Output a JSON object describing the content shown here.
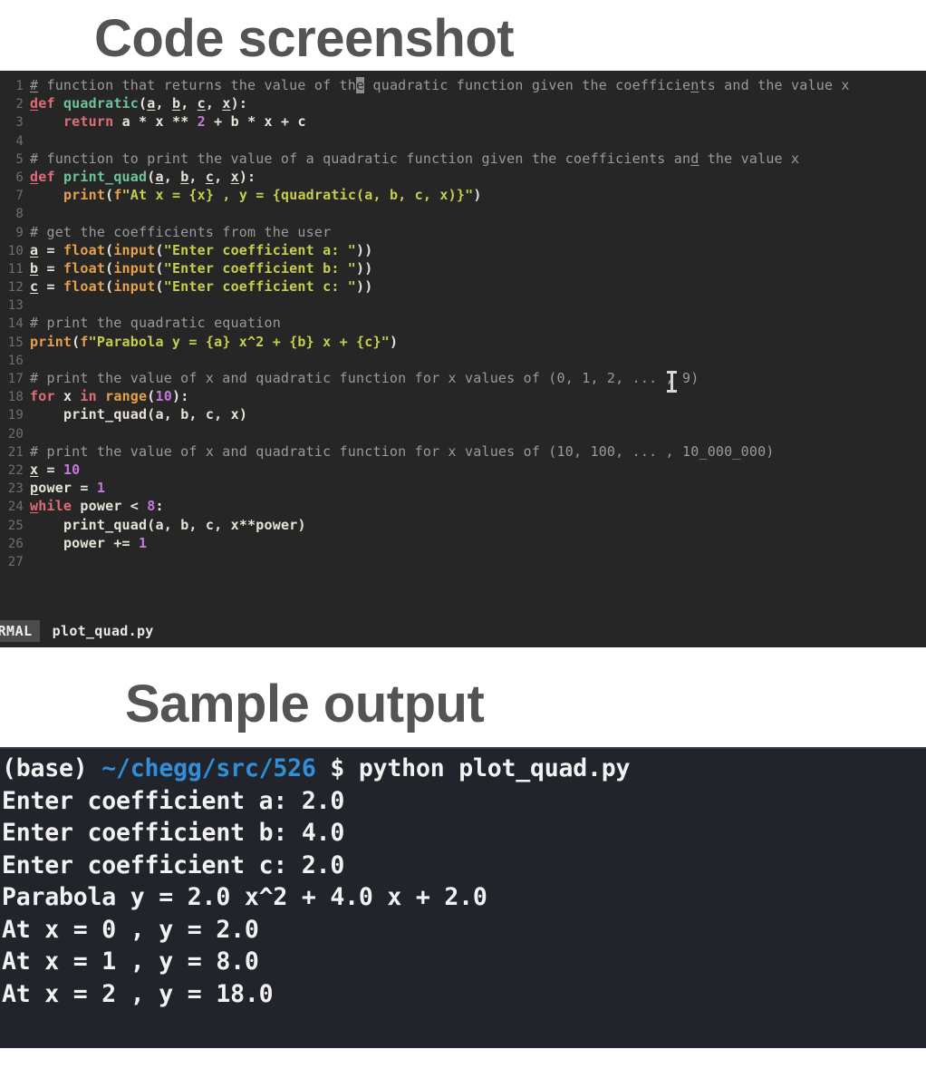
{
  "headings": {
    "code": "Code screenshot",
    "output": "Sample output"
  },
  "editor": {
    "background_color": "#262626",
    "gutter_color": "#6f6f6f",
    "filename": "plot_quad.py",
    "mode": "NORMAL",
    "mode_clipped_text": "ORMAL",
    "cursor": {
      "line": 1,
      "char": "e",
      "word": "the"
    },
    "mouse_cursor_icon": "i-beam-cursor",
    "lines": [
      {
        "n": "1",
        "text": "# function that returns the value of the quadratic function given the coefficients and the value x"
      },
      {
        "n": "2",
        "text": "def quadratic(a, b, c, x):"
      },
      {
        "n": "3",
        "text": "    return a * x ** 2 + b * x + c"
      },
      {
        "n": "4",
        "text": ""
      },
      {
        "n": "5",
        "text": "# function to print the value of a quadratic function given the coefficients and the value x"
      },
      {
        "n": "6",
        "text": "def print_quad(a, b, c, x):"
      },
      {
        "n": "7",
        "text": "    print(f\"At x = {x} , y = {quadratic(a, b, c, x)}\")"
      },
      {
        "n": "8",
        "text": ""
      },
      {
        "n": "9",
        "text": "# get the coefficients from the user"
      },
      {
        "n": "10",
        "text": "a = float(input(\"Enter coefficient a: \"))"
      },
      {
        "n": "11",
        "text": "b = float(input(\"Enter coefficient b: \"))"
      },
      {
        "n": "12",
        "text": "c = float(input(\"Enter coefficient c: \"))"
      },
      {
        "n": "13",
        "text": ""
      },
      {
        "n": "14",
        "text": "# print the quadratic equation"
      },
      {
        "n": "15",
        "text": "print(f\"Parabola y = {a} x^2 + {b} x + {c}\")"
      },
      {
        "n": "16",
        "text": ""
      },
      {
        "n": "17",
        "text": "# print the value of x and quadratic function for x values of (0, 1, 2, ... , 9)"
      },
      {
        "n": "18",
        "text": "for x in range(10):"
      },
      {
        "n": "19",
        "text": "    print_quad(a, b, c, x)"
      },
      {
        "n": "20",
        "text": ""
      },
      {
        "n": "21",
        "text": "# print the value of x and quadratic function for x values of (10, 100, ... , 10_000_000)"
      },
      {
        "n": "22",
        "text": "x = 10"
      },
      {
        "n": "23",
        "text": "power = 1"
      },
      {
        "n": "24",
        "text": "while power < 8:"
      },
      {
        "n": "25",
        "text": "    print_quad(a, b, c, x**power)"
      },
      {
        "n": "26",
        "text": "    power += 1"
      },
      {
        "n": "27",
        "text": ""
      }
    ]
  },
  "terminal": {
    "background_color": "#21252b",
    "prompt_env": "(base)",
    "prompt_path": "~/chegg/src/526",
    "prompt_symbol": "$",
    "command": "python plot_quad.py",
    "output_lines": [
      "Enter coefficient a: 2.0",
      "Enter coefficient b: 4.0",
      "Enter coefficient c: 2.0",
      "Parabola y = 2.0 x^2 + 4.0 x + 2.0",
      "At x = 0 , y = 2.0",
      "At x = 1 , y = 8.0",
      "At x = 2 , y = 18.0"
    ]
  },
  "colors": {
    "heading": "#545454",
    "keyword": "#e06c75",
    "function": "#6cc49a",
    "builtin": "#e5a04c",
    "string": "#c5cf4b",
    "number": "#c678dd",
    "comment": "#9a9a9a",
    "prompt_path": "#2f8fd8"
  }
}
